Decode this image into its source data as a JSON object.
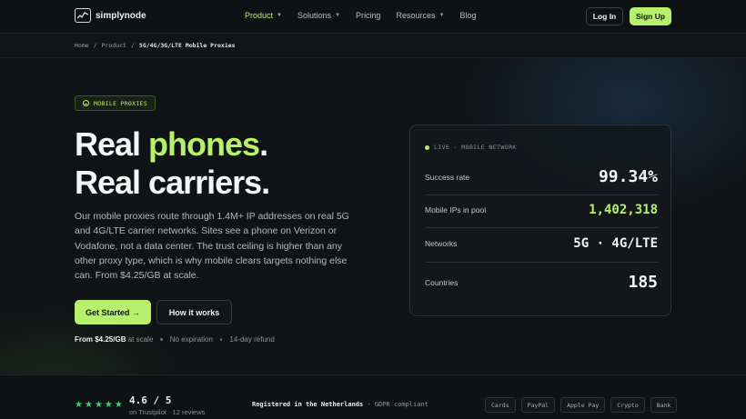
{
  "nav": {
    "brand": "simplynode",
    "items": [
      {
        "label": "Product",
        "dropdown": true,
        "active": true
      },
      {
        "label": "Solutions",
        "dropdown": true,
        "active": false
      },
      {
        "label": "Pricing",
        "dropdown": false,
        "active": false
      },
      {
        "label": "Resources",
        "dropdown": true,
        "active": false
      },
      {
        "label": "Blog",
        "dropdown": false,
        "active": false
      }
    ],
    "login_label": "Log In",
    "signup_label": "Sign Up"
  },
  "breadcrumb": {
    "items": [
      "Home",
      "Product",
      "5G/4G/3G/LTE Mobile Proxies"
    ],
    "separator": "/"
  },
  "hero": {
    "badge": "MOBILE PROXIES",
    "title_line1_pre": "Real ",
    "title_line1_accent": "phones",
    "title_line1_post": ".",
    "title_line2": "Real carriers.",
    "lead": "Our mobile proxies route through 1.4M+ IP addresses on real 5G and 4G/LTE carrier networks. Sites see a phone on Verizon or Vodafone, not a data center. The trust ceiling is higher than any other proxy type, which is why mobile clears targets nothing else can. From $4.25/GB at scale.",
    "cta_primary": "Get Started →",
    "cta_secondary": "How it works",
    "price_bold": "From $4.25/GB",
    "price_suffix": "at scale",
    "note1": "No expiration",
    "note2": "14-day refund"
  },
  "stats": {
    "header": "LIVE · MOBILE NETWORK",
    "rows": [
      {
        "label": "Success rate",
        "value": "99.34%"
      },
      {
        "label": "Mobile IPs in pool",
        "value": "1,402,318"
      },
      {
        "label": "Networks",
        "value": "5G · 4G/LTE"
      },
      {
        "label": "Countries",
        "value": "185"
      }
    ]
  },
  "trust": {
    "stars": 5,
    "rating": "4.6 / 5",
    "source": "on Trustpilot",
    "reviews": "12 reviews",
    "registered": "Registered in the Netherlands",
    "gdpr": "· GDPR compliant",
    "payments": [
      "Cards",
      "PayPal",
      "Apple Pay",
      "Crypto",
      "Bank"
    ]
  },
  "colors": {
    "accent": "#b7f06a",
    "background": "#101315",
    "star": "#3fca7c"
  }
}
